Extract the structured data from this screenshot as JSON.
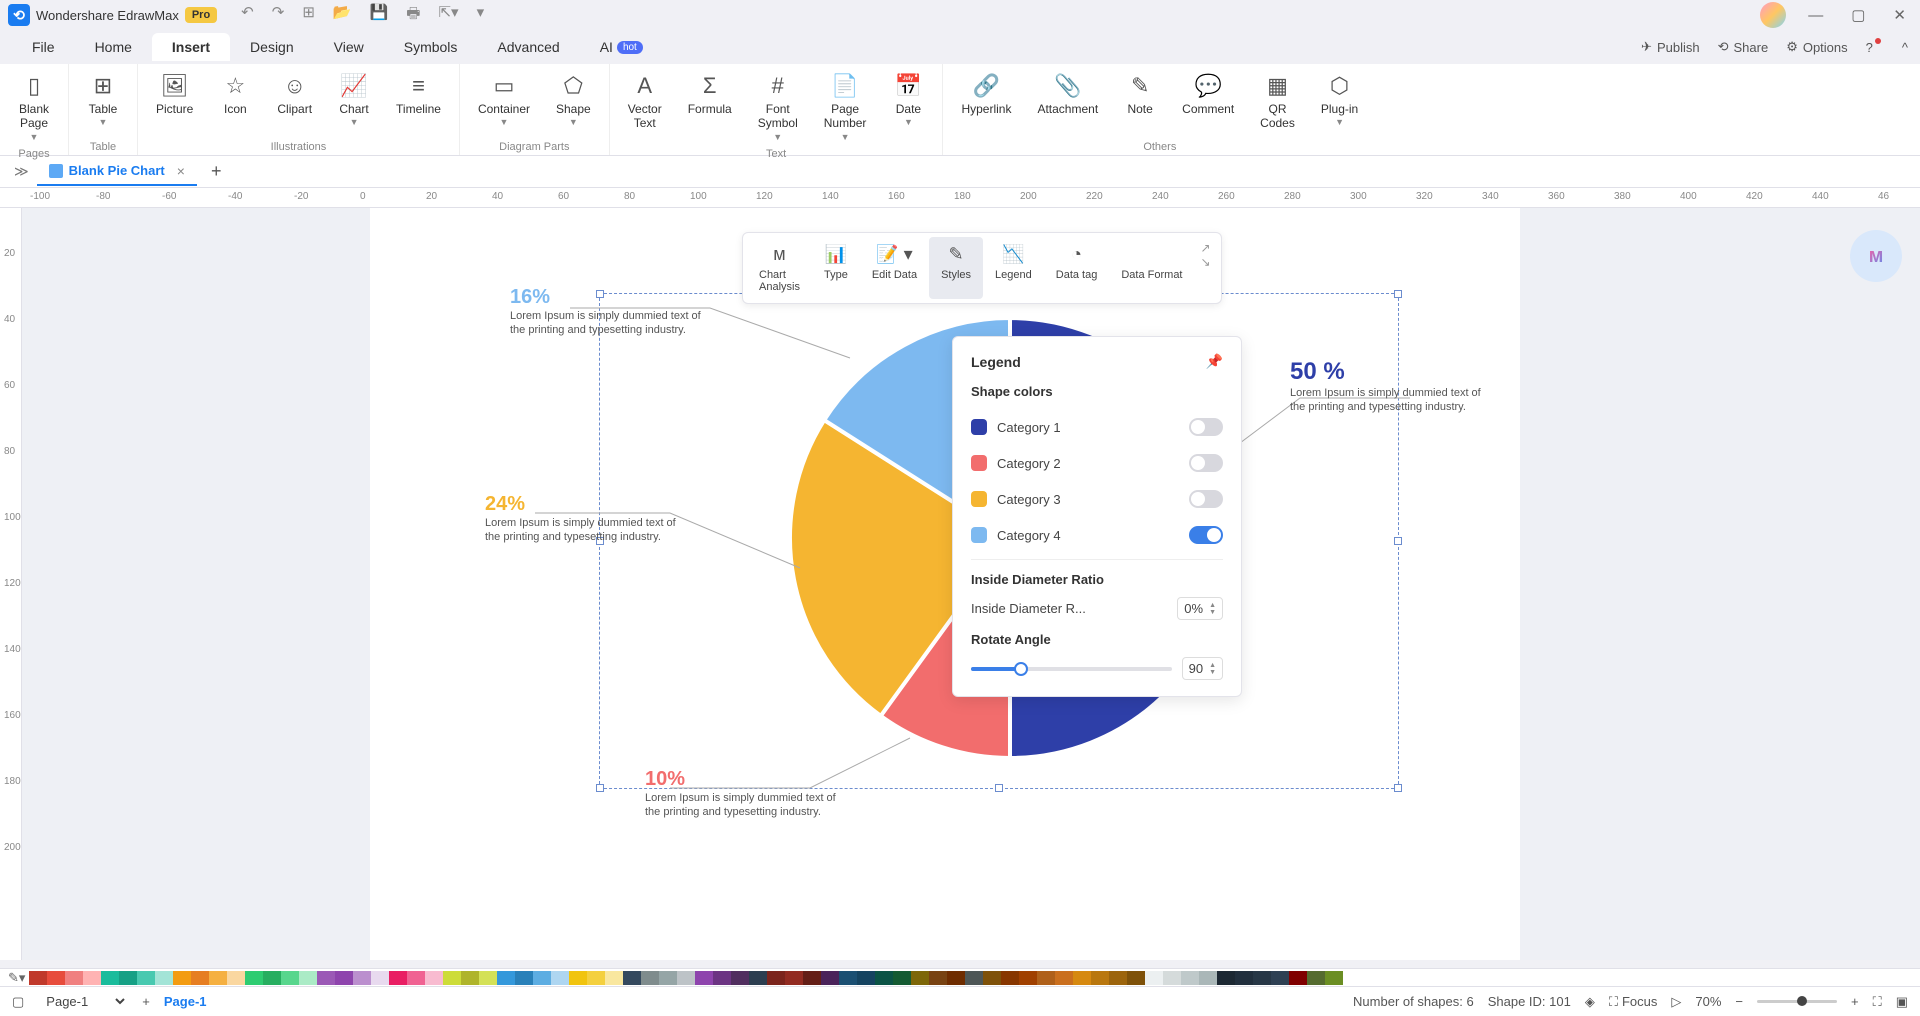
{
  "app": {
    "title": "Wondershare EdrawMax",
    "badge": "Pro"
  },
  "menus": [
    "File",
    "Home",
    "Insert",
    "Design",
    "View",
    "Symbols",
    "Advanced",
    "AI"
  ],
  "activeMenu": "Insert",
  "aiBadge": "hot",
  "topRight": {
    "publish": "Publish",
    "share": "Share",
    "options": "Options"
  },
  "ribbon": {
    "groups": [
      {
        "label": "Pages",
        "buttons": [
          {
            "name": "blank-page",
            "l1": "Blank",
            "l2": "Page",
            "dd": true
          }
        ]
      },
      {
        "label": "Table",
        "buttons": [
          {
            "name": "table",
            "l1": "Table",
            "dd": true
          }
        ]
      },
      {
        "label": "Illustrations",
        "buttons": [
          {
            "name": "picture",
            "l1": "Picture"
          },
          {
            "name": "icon",
            "l1": "Icon"
          },
          {
            "name": "clipart",
            "l1": "Clipart"
          },
          {
            "name": "chart",
            "l1": "Chart",
            "dd": true
          },
          {
            "name": "timeline",
            "l1": "Timeline"
          }
        ]
      },
      {
        "label": "Diagram Parts",
        "buttons": [
          {
            "name": "container",
            "l1": "Container",
            "dd": true
          },
          {
            "name": "shape",
            "l1": "Shape",
            "dd": true
          }
        ]
      },
      {
        "label": "Text",
        "buttons": [
          {
            "name": "vector-text",
            "l1": "Vector",
            "l2": "Text"
          },
          {
            "name": "formula",
            "l1": "Formula"
          },
          {
            "name": "font-symbol",
            "l1": "Font",
            "l2": "Symbol",
            "dd": true
          },
          {
            "name": "page-number",
            "l1": "Page",
            "l2": "Number",
            "dd": true
          },
          {
            "name": "date",
            "l1": "Date",
            "dd": true
          }
        ]
      },
      {
        "label": "Others",
        "buttons": [
          {
            "name": "hyperlink",
            "l1": "Hyperlink"
          },
          {
            "name": "attachment",
            "l1": "Attachment"
          },
          {
            "name": "note",
            "l1": "Note"
          },
          {
            "name": "comment",
            "l1": "Comment"
          },
          {
            "name": "qr-codes",
            "l1": "QR",
            "l2": "Codes"
          },
          {
            "name": "plug-in",
            "l1": "Plug‑in",
            "dd": true
          }
        ]
      }
    ]
  },
  "docTab": "Blank Pie Chart",
  "rulerH": [
    "-100",
    "-80",
    "-60",
    "-40",
    "-20",
    "0",
    "20",
    "40",
    "60",
    "80",
    "100",
    "120",
    "140",
    "160",
    "180",
    "200",
    "220",
    "240",
    "260",
    "280",
    "300",
    "320",
    "340",
    "360",
    "380",
    "400",
    "420",
    "440",
    "46"
  ],
  "rulerV": [
    "20",
    "40",
    "60",
    "80",
    "100",
    "120",
    "140",
    "160",
    "180",
    "200"
  ],
  "floatToolbar": {
    "items": [
      {
        "name": "chart-analysis",
        "l1": "Chart",
        "l2": "Analysis"
      },
      {
        "name": "type",
        "l1": "Type"
      },
      {
        "name": "edit-data",
        "l1": "Edit Data",
        "dd": true
      },
      {
        "name": "styles",
        "l1": "Styles",
        "active": true
      },
      {
        "name": "legend",
        "l1": "Legend"
      },
      {
        "name": "data-tag",
        "l1": "Data tag"
      },
      {
        "name": "data-format",
        "l1": "Data Format"
      }
    ]
  },
  "legendPanel": {
    "title": "Legend",
    "shapeColors": "Shape colors",
    "categories": [
      {
        "label": "Category 1",
        "color": "#2e3fa8",
        "on": false
      },
      {
        "label": "Category 2",
        "color": "#f26d6d",
        "on": false
      },
      {
        "label": "Category 3",
        "color": "#f5b531",
        "on": false
      },
      {
        "label": "Category 4",
        "color": "#7db9f0",
        "on": true
      }
    ],
    "insideDiameterTitle": "Inside Diameter Ratio",
    "insideDiameterLabel": "Inside Diameter R...",
    "insideDiameterValue": "0%",
    "rotateAngleTitle": "Rotate Angle",
    "rotateAngleValue": "90"
  },
  "chart_data": {
    "type": "pie",
    "title": "",
    "categories": [
      "Category 1",
      "Category 2",
      "Category 3",
      "Category 4"
    ],
    "values": [
      50,
      10,
      24,
      16
    ],
    "colors": [
      "#2e3fa8",
      "#f26d6d",
      "#f5b531",
      "#7db9f0"
    ],
    "labels": [
      {
        "pct": "50 %",
        "desc": "Lorem Ipsum is simply dummied text of the printing and typesetting industry.",
        "color": "#2e3fa8"
      },
      {
        "pct": "10%",
        "desc": "Lorem Ipsum is simply dummied text of the printing and typesetting industry.",
        "color": "#f26d6d"
      },
      {
        "pct": "24%",
        "desc": "Lorem Ipsum is simply dummied text of the printing and typesetting industry.",
        "color": "#f5b531"
      },
      {
        "pct": "16%",
        "desc": "Lorem Ipsum is simply dummied text of the printing and typesetting industry.",
        "color": "#7db9f0"
      }
    ],
    "rotate_angle": 90,
    "inside_diameter_ratio": 0
  },
  "palette": [
    "#c0392b",
    "#e74c3c",
    "#f08080",
    "#ffb3b3",
    "#1abc9c",
    "#16a085",
    "#48c9b0",
    "#a3e4d7",
    "#f39c12",
    "#e67e22",
    "#f5b041",
    "#fad7a0",
    "#2ecc71",
    "#27ae60",
    "#58d68d",
    "#abebc6",
    "#9b59b6",
    "#8e44ad",
    "#bb8fce",
    "#e8daef",
    "#e91e63",
    "#f06292",
    "#f8bbd0",
    "#cddc39",
    "#afb42b",
    "#d4e157",
    "#3498db",
    "#2980b9",
    "#5dade2",
    "#aed6f1",
    "#f1c40f",
    "#f4d03f",
    "#f9e79f",
    "#34495e",
    "#7f8c8d",
    "#95a5a6",
    "#bdc3c7",
    "#8e44ad",
    "#6c3483",
    "#512e5f",
    "#2c3e50",
    "#7b241c",
    "#922b21",
    "#641e16",
    "#4a235a",
    "#1b4f72",
    "#154360",
    "#0b5345",
    "#145a32",
    "#7d6608",
    "#784212",
    "#6e2c00",
    "#4d5656",
    "#7e5109",
    "#873600",
    "#a04000",
    "#af601a",
    "#ca6f1e",
    "#d68910",
    "#b9770e",
    "#9c640c",
    "#7e5109",
    "#ecf0f1",
    "#d5dbdb",
    "#bfc9ca",
    "#aab7b8",
    "#1c2833",
    "#212f3d",
    "#273746",
    "#2e4053",
    "#800000",
    "#556b2f",
    "#6b8e23"
  ],
  "status": {
    "pageSelect": "Page-1",
    "pageTab": "Page-1",
    "shapes": "Number of shapes: 6",
    "shapeId": "Shape ID: 101",
    "focus": "Focus",
    "zoom": "70%"
  }
}
